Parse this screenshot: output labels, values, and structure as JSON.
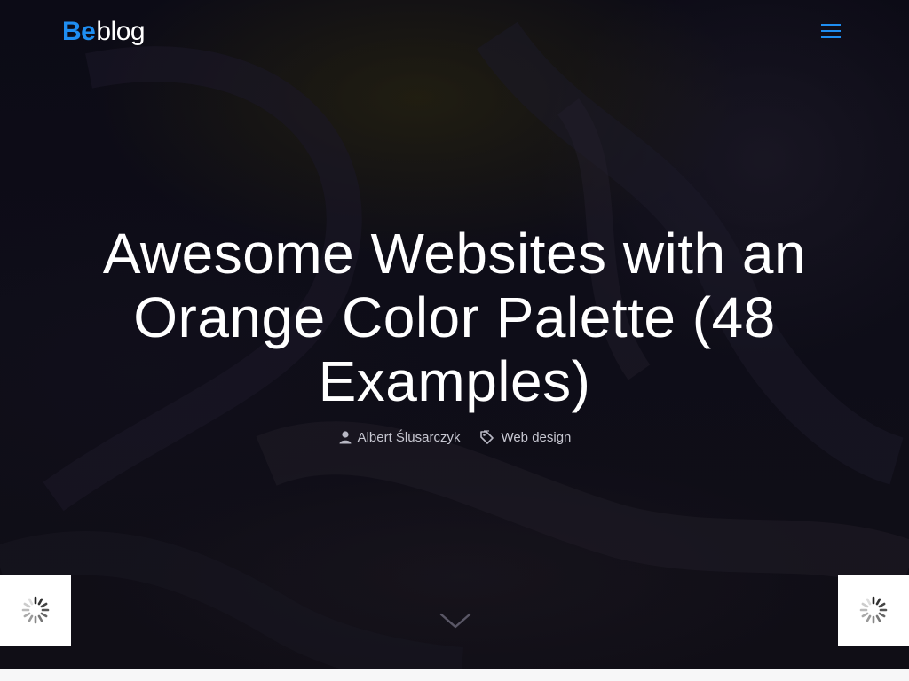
{
  "header": {
    "logo_be": "Be",
    "logo_blog": "blog",
    "menu_icon": "hamburger-menu-icon",
    "accent_color": "#1f8ef1"
  },
  "hero": {
    "title": "Awesome Websites with an Orange Color Palette (48 Examples)",
    "author_icon": "user-icon",
    "author": "Albert Ślusarczyk",
    "category_icon": "tags-icon",
    "category": "Web design",
    "scroll_icon": "chevron-down-icon"
  },
  "loaders": {
    "left_icon": "spinner-icon",
    "right_icon": "spinner-icon"
  }
}
